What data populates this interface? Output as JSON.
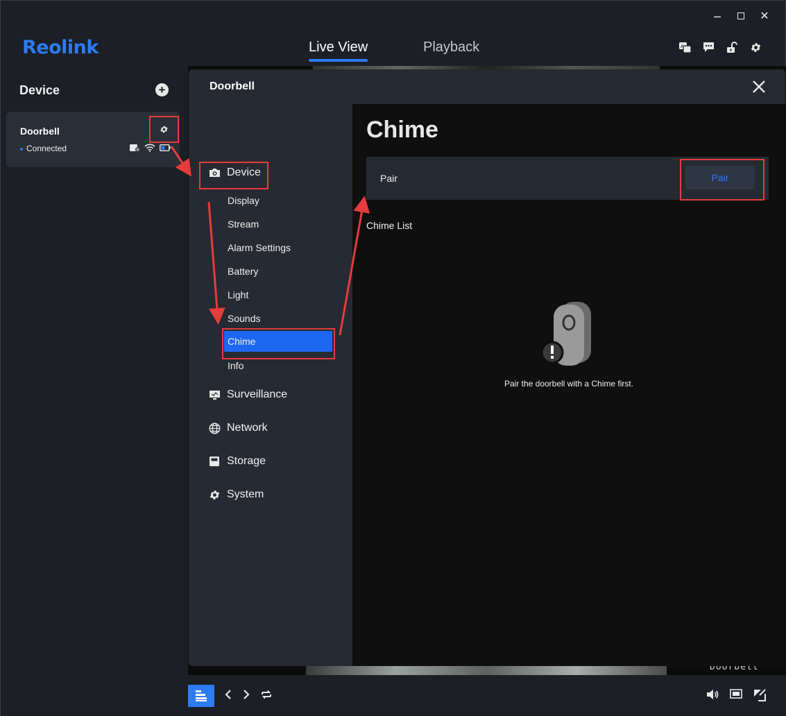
{
  "header": {
    "logo": "Reolink",
    "tabs": [
      {
        "label": "Live View",
        "active": true
      },
      {
        "label": "Playback",
        "active": false
      }
    ],
    "icons": [
      "translate-icon",
      "message-icon",
      "unlock-icon",
      "settings-icon"
    ]
  },
  "sidebar": {
    "title": "Device",
    "add_icon": "+",
    "device": {
      "name": "Doorbell",
      "status": "Connected"
    }
  },
  "modal": {
    "title": "Doorbell",
    "nav": {
      "groups": [
        {
          "label": "Device",
          "icon": "camera-icon"
        },
        {
          "label": "Surveillance",
          "icon": "monitor-icon"
        },
        {
          "label": "Network",
          "icon": "globe-icon"
        },
        {
          "label": "Storage",
          "icon": "storage-icon"
        },
        {
          "label": "System",
          "icon": "gear-icon"
        }
      ],
      "device_items": [
        "Display",
        "Stream",
        "Alarm Settings",
        "Battery",
        "Light",
        "Sounds",
        "Chime",
        "Info"
      ],
      "active_item": "Chime"
    },
    "content": {
      "title": "Chime",
      "pair_label": "Pair",
      "pair_button": "Pair",
      "chime_list_label": "Chime List",
      "empty_message": "Pair the doorbell with a Chime first."
    }
  },
  "video": {
    "overlay_text": "Doorbell"
  },
  "colors": {
    "accent": "#2d7bf0",
    "active_nav": "#1d67f0",
    "highlight": "#e53c3c",
    "background": "#1c1f26",
    "panel": "#262a32",
    "content": "#0f0f10"
  }
}
